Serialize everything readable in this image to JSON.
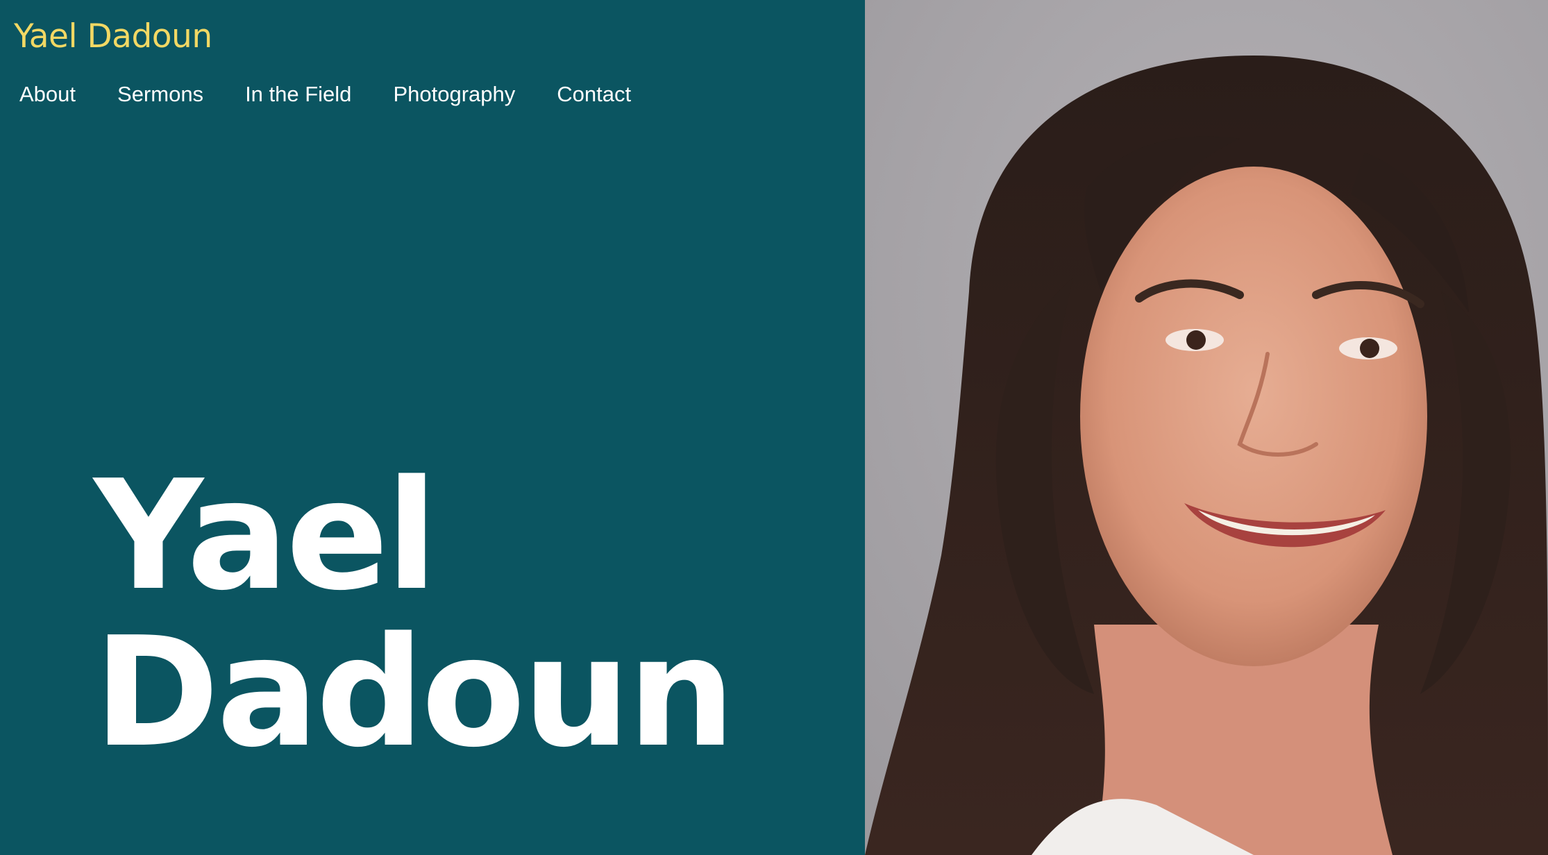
{
  "site": {
    "title": "Yael Dadoun"
  },
  "nav": {
    "items": [
      {
        "label": "About"
      },
      {
        "label": "Sermons"
      },
      {
        "label": "In the Field"
      },
      {
        "label": "Photography"
      },
      {
        "label": "Contact"
      }
    ]
  },
  "hero": {
    "name_line1": "Yael",
    "name_line2": "Dadoun"
  },
  "colors": {
    "panel_background": "#0b5561",
    "title_accent": "#f2d864",
    "photo_background": "#a8a5a9"
  },
  "images": {
    "portrait": "portrait-photo"
  }
}
